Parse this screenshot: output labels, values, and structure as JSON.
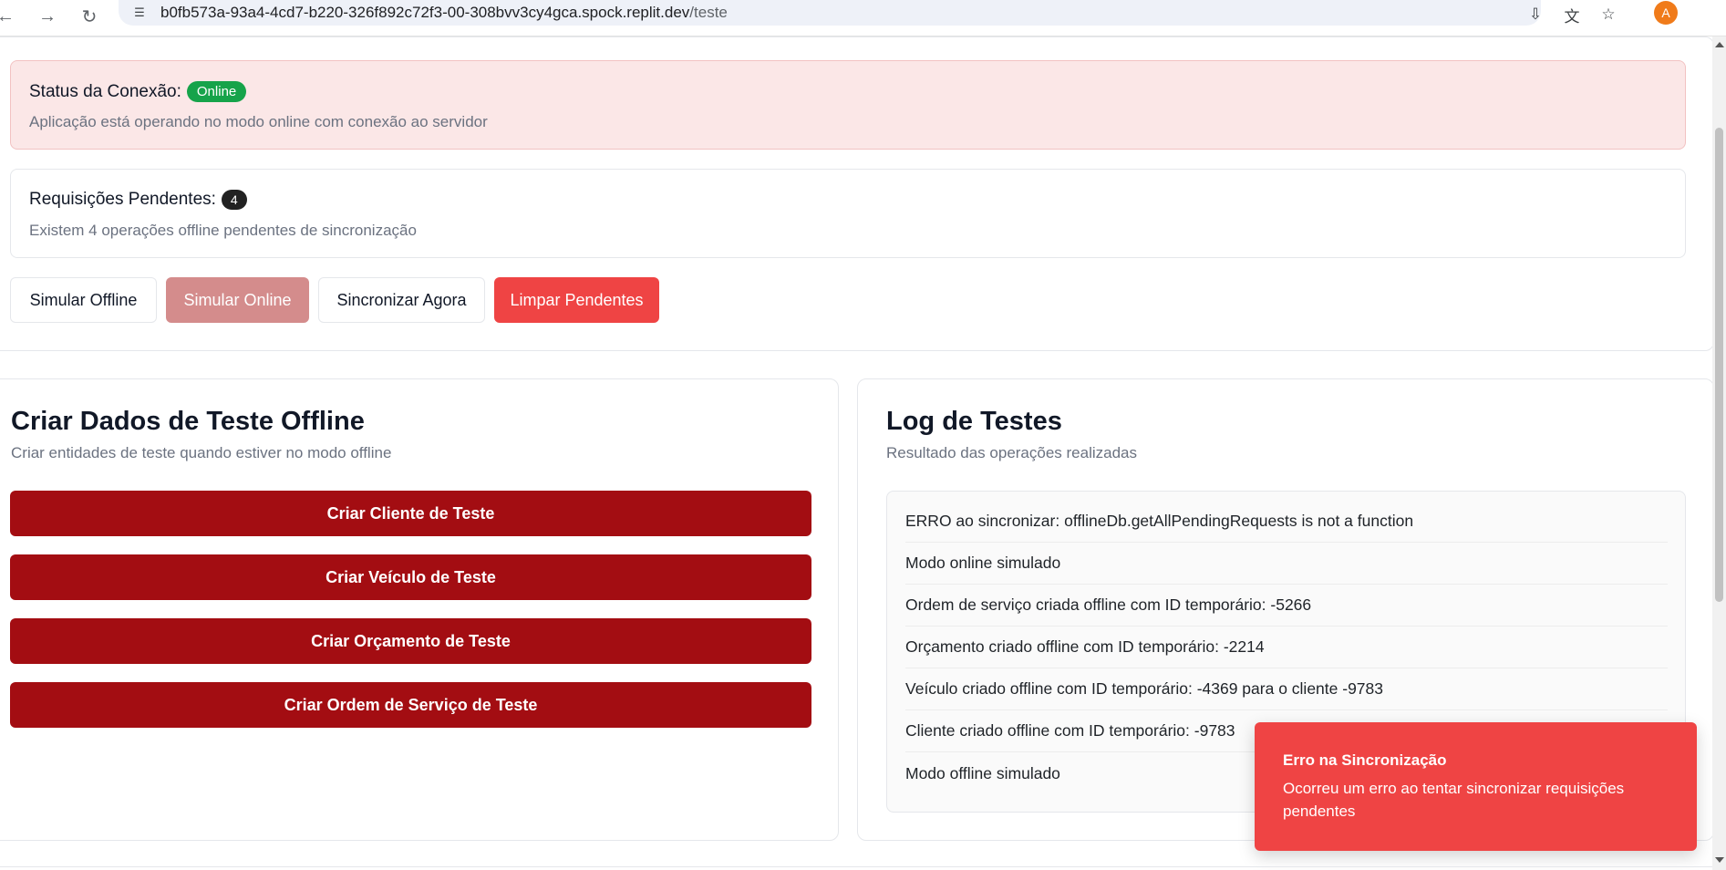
{
  "browser": {
    "url_host": "b0fb573a-93a4-4cd7-b220-326f892c72f3-00-308bvv3cy4gca.spock.replit.dev",
    "url_path": "/teste",
    "avatar_letter": "A",
    "icons": [
      "back-icon",
      "forward-icon",
      "reload-icon",
      "site-settings-icon",
      "install-icon",
      "translate-icon",
      "star-icon"
    ]
  },
  "status": {
    "title": "Status da Conexão:",
    "badge": "Online",
    "badge_color": "#16a34a",
    "description": "Aplicação está operando no modo online com conexão ao servidor"
  },
  "pending": {
    "title": "Requisições Pendentes:",
    "count": "4",
    "description": "Existem 4 operações offline pendentes de sincronização"
  },
  "actions": {
    "simulate_offline": "Simular Offline",
    "simulate_online": "Simular Online",
    "sync_now": "Sincronizar Agora",
    "clear_pending": "Limpar Pendentes"
  },
  "create_card": {
    "title": "Criar Dados de Teste Offline",
    "subtitle": "Criar entidades de teste quando estiver no modo offline",
    "buttons": [
      "Criar Cliente de Teste",
      "Criar Veículo de Teste",
      "Criar Orçamento de Teste",
      "Criar Ordem de Serviço de Teste"
    ],
    "button_color": "#a30d12"
  },
  "log_card": {
    "title": "Log de Testes",
    "subtitle": "Resultado das operações realizadas",
    "entries": [
      "ERRO ao sincronizar: offlineDb.getAllPendingRequests is not a function",
      "Modo online simulado",
      "Ordem de serviço criada offline com ID temporário: -5266",
      "Orçamento criado offline com ID temporário: -2214",
      "Veículo criado offline com ID temporário: -4369 para o cliente -9783",
      "Cliente criado offline com ID temporário: -9783",
      "Modo offline simulado"
    ]
  },
  "toast": {
    "title": "Erro na Sincronização",
    "description": "Ocorreu um erro ao tentar sincronizar requisições pendentes",
    "color": "#ef4444"
  }
}
